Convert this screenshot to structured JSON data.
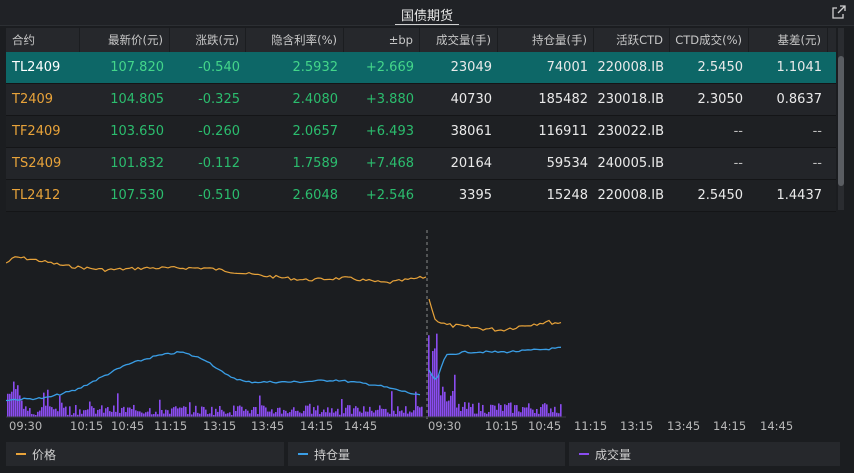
{
  "title": "国债期货",
  "headers": [
    "合约",
    "最新价(元)",
    "涨跌(元)",
    "隐含利率(%)",
    "±bp",
    "成交量(手)",
    "持仓量(手)",
    "活跃CTD",
    "CTD成交(%)",
    "基差(元)"
  ],
  "rows": [
    {
      "sym": "TL2409",
      "price": "107.820",
      "chg": "-0.540",
      "rate": "2.5932",
      "bp": "+2.669",
      "vol": "23049",
      "oi": "74001",
      "ctd": "220008.IB",
      "ctdp": "2.5450",
      "basis": "1.1041"
    },
    {
      "sym": "T2409",
      "price": "104.805",
      "chg": "-0.325",
      "rate": "2.4080",
      "bp": "+3.880",
      "vol": "40730",
      "oi": "185482",
      "ctd": "230018.IB",
      "ctdp": "2.3050",
      "basis": "0.8637"
    },
    {
      "sym": "TF2409",
      "price": "103.650",
      "chg": "-0.260",
      "rate": "2.0657",
      "bp": "+6.493",
      "vol": "38061",
      "oi": "116911",
      "ctd": "230022.IB",
      "ctdp": "--",
      "basis": "--"
    },
    {
      "sym": "TS2409",
      "price": "101.832",
      "chg": "-0.112",
      "rate": "1.7589",
      "bp": "+7.468",
      "vol": "20164",
      "oi": "59534",
      "ctd": "240005.IB",
      "ctdp": "--",
      "basis": "--"
    },
    {
      "sym": "TL2412",
      "price": "107.530",
      "chg": "-0.510",
      "rate": "2.6048",
      "bp": "+2.546",
      "vol": "3395",
      "oi": "15248",
      "ctd": "220008.IB",
      "ctdp": "2.5450",
      "basis": "1.4437"
    }
  ],
  "x_ticks": [
    "09:30",
    "10:15",
    "10:45",
    "11:15",
    "13:15",
    "13:45",
    "14:15",
    "14:45",
    "09:30",
    "10:15",
    "10:45",
    "11:15",
    "13:15",
    "13:45",
    "14:15",
    "14:45"
  ],
  "legend": [
    {
      "label": "价格",
      "color": "#e8a33a"
    },
    {
      "label": "持仓量",
      "color": "#3a9ee6"
    },
    {
      "label": "成交量",
      "color": "#8a4cf0"
    }
  ],
  "colors": {
    "price": "#e8a33a",
    "oi": "#3a9ee6",
    "vol": "#8a4cf0",
    "selected": "#0d6767",
    "up": "#2bbd6e"
  }
}
